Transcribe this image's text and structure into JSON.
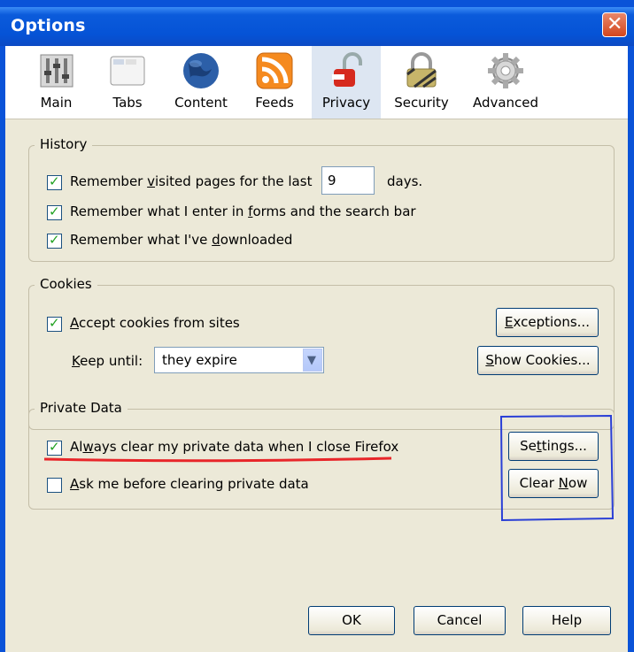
{
  "window": {
    "title": "Options",
    "close_glyph": "✕"
  },
  "toolbar": {
    "tabs": [
      {
        "label": "Main",
        "icon": "main-icon"
      },
      {
        "label": "Tabs",
        "icon": "tabs-icon"
      },
      {
        "label": "Content",
        "icon": "content-globe-icon"
      },
      {
        "label": "Feeds",
        "icon": "rss-feeds-icon"
      },
      {
        "label": "Privacy",
        "icon": "privacy-lock-icon",
        "selected": true
      },
      {
        "label": "Security",
        "icon": "security-padlock-icon"
      },
      {
        "label": "Advanced",
        "icon": "advanced-gear-icon"
      }
    ]
  },
  "history": {
    "legend": "History",
    "remember_visited_pre": "Remember ",
    "remember_visited_u": "v",
    "remember_visited_post": "isited pages for the last",
    "days_value": "9",
    "days_label": "days.",
    "remember_forms_pre": "Remember what I enter in ",
    "remember_forms_u": "f",
    "remember_forms_post": "orms and the search bar",
    "remember_downloads_pre": "Remember what I've ",
    "remember_downloads_u": "d",
    "remember_downloads_post": "ownloaded"
  },
  "cookies": {
    "legend": "Cookies",
    "accept_u": "A",
    "accept_post": "ccept cookies from sites",
    "keep_until_label": "Keep until:",
    "keep_until_value": "they expire",
    "exceptions_u": "E",
    "exceptions_post": "xceptions...",
    "show_cookies_u": "S",
    "show_cookies_post": "how Cookies..."
  },
  "private_data": {
    "legend": "Private Data",
    "always_clear_pre": "Al",
    "always_clear_u": "w",
    "always_clear_post": "ays clear my private data when I close Firefox",
    "ask_u": "A",
    "ask_post": "sk me before clearing private data",
    "settings_pre": "Se",
    "settings_u": "t",
    "settings_post": "tings...",
    "clear_now_pre": "Clear ",
    "clear_now_u": "N",
    "clear_now_post": "ow"
  },
  "footer": {
    "ok": "OK",
    "cancel": "Cancel",
    "help": "Help"
  },
  "colors": {
    "annotation_red": "#e8262a",
    "annotation_blue": "#2a3fd6",
    "check_green": "#21a121"
  }
}
